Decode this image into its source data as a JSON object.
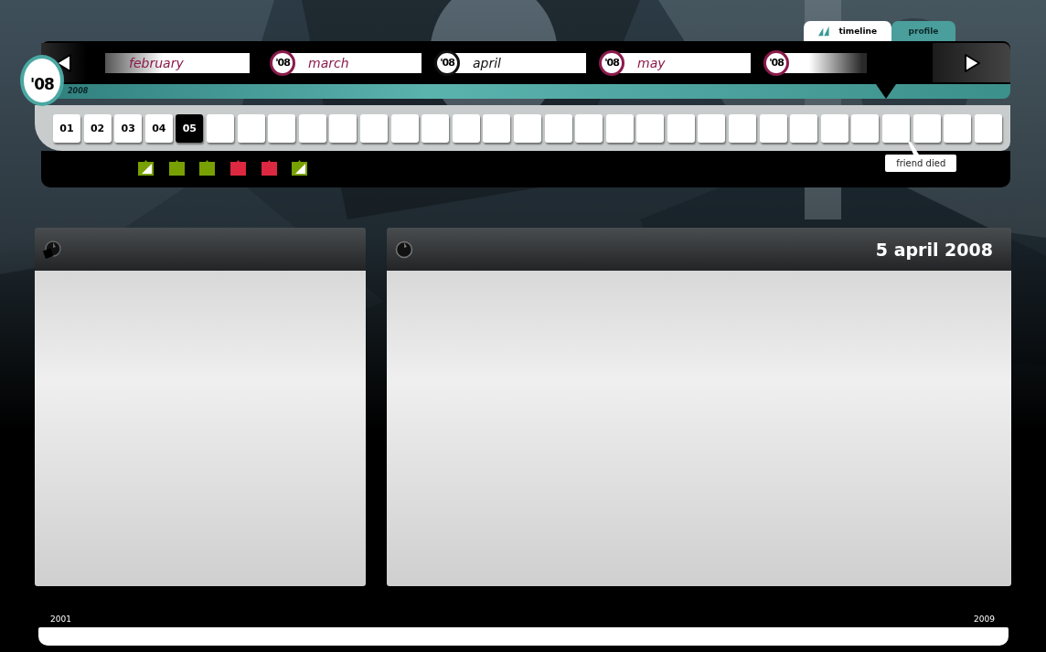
{
  "tabs": [
    {
      "label": "timeline",
      "selected": true,
      "icon": true
    },
    {
      "label": "profile",
      "selected": false
    }
  ],
  "logo": {
    "text": "'08",
    "year": "2008"
  },
  "months": [
    {
      "name": "february",
      "color": "#8b1a4b",
      "kind": "fade-in"
    },
    {
      "name": "march",
      "badge": "'08",
      "color": "#8b1a4b",
      "kind": "plain"
    },
    {
      "name": "april",
      "badge": "'08",
      "color": "#111111",
      "kind": "plain"
    },
    {
      "name": "may",
      "badge": "'08",
      "color": "#8b1a4b",
      "kind": "plain"
    },
    {
      "badge": "'08",
      "color": "#8b1a4b",
      "kind": "fade-out"
    }
  ],
  "days": [
    {
      "label": "01",
      "selected": false
    },
    {
      "label": "02",
      "selected": false
    },
    {
      "label": "03",
      "selected": false,
      "marker": {
        "kind": "half",
        "color": "#78a000"
      }
    },
    {
      "label": "04",
      "selected": false,
      "marker": {
        "kind": "full",
        "color": "#78a000"
      }
    },
    {
      "label": "05",
      "selected": true,
      "marker": {
        "kind": "full",
        "color": "#78a000"
      }
    },
    {
      "selected": false,
      "marker": {
        "kind": "full",
        "color": "#dc2840"
      }
    },
    {
      "selected": false,
      "marker": {
        "kind": "full",
        "color": "#dc2840"
      }
    },
    {
      "selected": false,
      "marker": {
        "kind": "half",
        "color": "#78a000"
      }
    },
    {
      "selected": false
    },
    {
      "selected": false
    },
    {
      "selected": false
    },
    {
      "selected": false
    },
    {
      "selected": false
    },
    {
      "selected": false
    },
    {
      "selected": false
    },
    {
      "selected": false
    },
    {
      "selected": false
    },
    {
      "selected": false
    },
    {
      "selected": false
    },
    {
      "selected": false
    },
    {
      "selected": false
    },
    {
      "selected": false
    },
    {
      "selected": false
    },
    {
      "selected": false
    },
    {
      "selected": false
    },
    {
      "selected": false
    },
    {
      "selected": false
    },
    {
      "selected": false,
      "note": "friend died"
    },
    {
      "selected": false
    },
    {
      "selected": false
    },
    {
      "selected": false
    }
  ],
  "panels": [
    {
      "kind": "left"
    },
    {
      "kind": "main",
      "title": "5 april 2008"
    }
  ],
  "range": {
    "start": "2001",
    "end": "2009"
  }
}
